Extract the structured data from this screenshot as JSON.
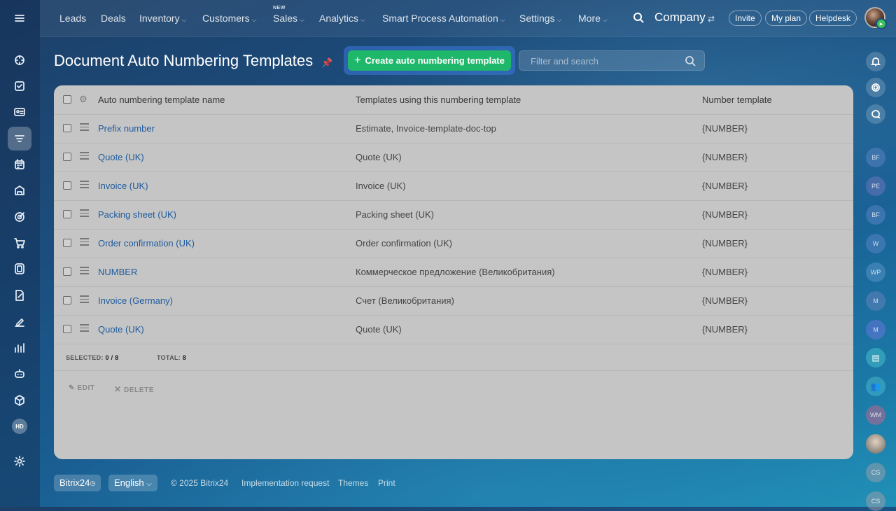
{
  "nav": {
    "items": [
      {
        "label": "Leads",
        "chevron": false
      },
      {
        "label": "Deals",
        "chevron": false
      },
      {
        "label": "Inventory",
        "chevron": true
      },
      {
        "label": "Customers",
        "chevron": true
      },
      {
        "label": "Sales",
        "chevron": true,
        "badge": "NEW"
      },
      {
        "label": "Analytics",
        "chevron": true
      },
      {
        "label": "Smart Process Automation",
        "chevron": true
      },
      {
        "label": "Settings",
        "chevron": true
      },
      {
        "label": "More",
        "chevron": true
      }
    ],
    "company": "Company",
    "invite": "Invite",
    "my_plan": "My plan",
    "helpdesk": "Helpdesk"
  },
  "page": {
    "title": "Document Auto Numbering Templates",
    "create_button": "Create auto numbering template",
    "filter_placeholder": "Filter and search"
  },
  "table": {
    "headers": [
      "Auto numbering template name",
      "Templates using this numbering template",
      "Number template"
    ],
    "rows": [
      {
        "name": "Prefix number",
        "templates": "Estimate, Invoice-template-doc-top",
        "number": "{NUMBER}"
      },
      {
        "name": "Quote (UK)",
        "templates": "Quote (UK)",
        "number": "{NUMBER}"
      },
      {
        "name": "Invoice (UK)",
        "templates": "Invoice (UK)",
        "number": "{NUMBER}"
      },
      {
        "name": "Packing sheet (UK)",
        "templates": "Packing sheet (UK)",
        "number": "{NUMBER}"
      },
      {
        "name": "Order confirmation (UK)",
        "templates": "Order confirmation (UK)",
        "number": "{NUMBER}"
      },
      {
        "name": "NUMBER",
        "templates": "Коммерческое предложение (Великобритания)",
        "number": "{NUMBER}"
      },
      {
        "name": "Invoice (Germany)",
        "templates": "Счет (Великобритания)",
        "number": "{NUMBER}"
      },
      {
        "name": "Quote (UK)",
        "templates": "Quote (UK)",
        "number": "{NUMBER}"
      }
    ],
    "selected_label": "SELECTED:",
    "selected_value": "0 / 8",
    "total_label": "TOTAL:",
    "total_value": "8",
    "edit_label": "EDIT",
    "delete_label": "DELETE"
  },
  "right_sidebar": {
    "avatars": [
      "BF",
      "PE",
      "BF",
      "W",
      "WP",
      "M",
      "M",
      "",
      "",
      "WM",
      "",
      "CS",
      "CS"
    ]
  },
  "left_sidebar": {
    "hd_label": "HD"
  },
  "footer": {
    "brand": "Bitrix24",
    "language": "English",
    "copyright": "© 2025 Bitrix24",
    "implementation": "Implementation request",
    "themes": "Themes",
    "print": "Print"
  },
  "colors": {
    "accent_green": "#1fb86a",
    "link_blue": "#1f5b9e",
    "panel_bg": "#c5c5c5"
  }
}
